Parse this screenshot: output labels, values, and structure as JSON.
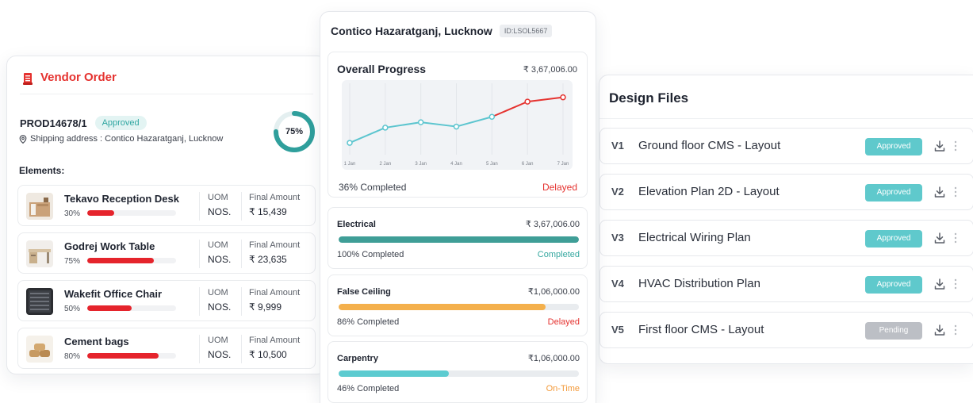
{
  "vendor_order": {
    "title": "Vendor Order",
    "product_id": "PROD14678/1",
    "status": "Approved",
    "shipping_address": "Shipping address : Contico Hazaratganj, Lucknow",
    "progress_label": "75%",
    "progress": 0.75,
    "elements_label": "Elements:",
    "uom_header": "UOM",
    "amount_header": "Final Amount",
    "elements": [
      {
        "name": "Tekavo Reception Desk",
        "percent_label": "30%",
        "percent": 30,
        "uom": "NOS.",
        "amount": "₹ 15,439",
        "icon": "reception-desk-thumbnail"
      },
      {
        "name": "Godrej Work Table",
        "percent_label": "75%",
        "percent": 75,
        "uom": "NOS.",
        "amount": "₹ 23,635",
        "icon": "work-table-thumbnail"
      },
      {
        "name": "Wakefit Office Chair",
        "percent_label": "50%",
        "percent": 50,
        "uom": "NOS.",
        "amount": "₹ 9,999",
        "icon": "office-chair-thumbnail"
      },
      {
        "name": "Cement bags",
        "percent_label": "80%",
        "percent": 80,
        "uom": "NOS.",
        "amount": "₹ 10,500",
        "icon": "cement-bags-thumbnail"
      }
    ],
    "accent_color": "#e5322f"
  },
  "project": {
    "name": "Contico Hazaratganj, Lucknow",
    "id_label": "ID:LSOL5667",
    "overall": {
      "title": "Overall Progress",
      "amount": "₹ 3,67,006.00",
      "completed_label": "36% Completed",
      "status": "Delayed",
      "status_color": "#e5322f"
    },
    "categories": [
      {
        "name": "Electrical",
        "amount": "₹ 3,67,006.00",
        "percent": 100,
        "percent_label": "100% Completed",
        "status": "Completed",
        "bar_color": "#3f9e97",
        "status_color": "#36a8a0"
      },
      {
        "name": "False Ceiling",
        "amount": "₹1,06,000.00",
        "percent": 86,
        "percent_label": "86% Completed",
        "status": "Delayed",
        "bar_color": "#f4b04c",
        "status_color": "#e5322f"
      },
      {
        "name": "Carpentry",
        "amount": "₹1,06,000.00",
        "percent": 46,
        "percent_label": "46% Completed",
        "status": "On-Time",
        "bar_color": "#5ccbd0",
        "status_color": "#f39a3a"
      }
    ]
  },
  "chart_data": {
    "type": "line",
    "x": [
      "1 Jan",
      "2 Jan",
      "3 Jan",
      "4 Jan",
      "5 Jan",
      "6 Jan",
      "7 Jan"
    ],
    "series": [
      {
        "values": [
          8,
          22,
          27,
          23,
          32,
          46,
          50
        ],
        "color_early": "#5cc5cf",
        "color_late": "#e5322f"
      }
    ],
    "ylim": [
      0,
      60
    ],
    "grid": true
  },
  "design_files": {
    "title": "Design Files",
    "files": [
      {
        "version": "V1",
        "name": "Ground floor CMS - Layout",
        "status": "Approved",
        "status_kind": "approved"
      },
      {
        "version": "V2",
        "name": "Elevation Plan 2D - Layout",
        "status": "Approved",
        "status_kind": "approved"
      },
      {
        "version": "V3",
        "name": "Electrical Wiring Plan",
        "status": "Approved",
        "status_kind": "approved"
      },
      {
        "version": "V4",
        "name": "HVAC Distribution Plan",
        "status": "Approved",
        "status_kind": "approved"
      },
      {
        "version": "V5",
        "name": "First floor CMS - Layout",
        "status": "Pending",
        "status_kind": "pending"
      }
    ],
    "download_icon": "download-icon",
    "more_icon": "more-vertical-icon"
  }
}
